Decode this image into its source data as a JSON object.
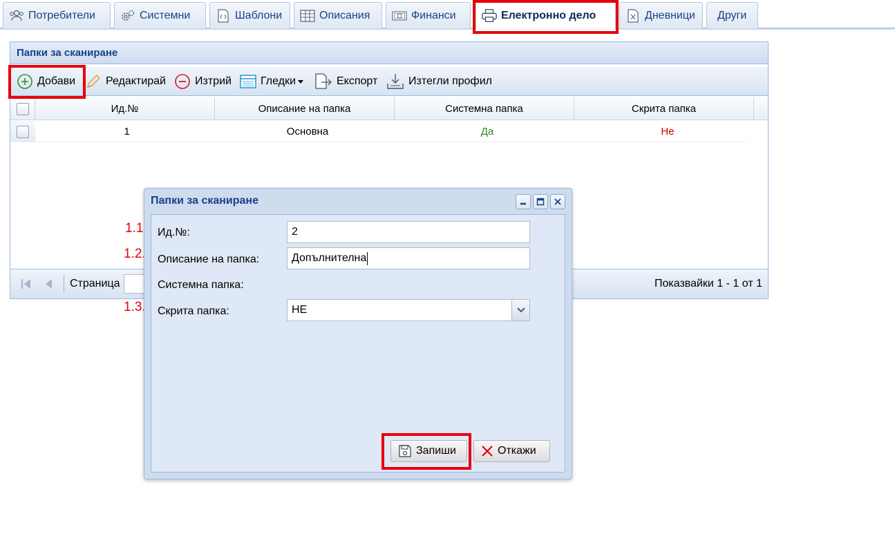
{
  "tabs": [
    {
      "label": "Потребители",
      "icon": "users-icon"
    },
    {
      "label": "Системни",
      "icon": "gears-icon"
    },
    {
      "label": "Шаблони",
      "icon": "code-file-icon"
    },
    {
      "label": "Описания",
      "icon": "table-icon"
    },
    {
      "label": "Финанси",
      "icon": "banknote-icon"
    },
    {
      "label": "Електронно дело",
      "icon": "printer-icon",
      "active": true
    },
    {
      "label": "Дневници",
      "icon": "excel-file-icon"
    },
    {
      "label": "Други",
      "icon": ""
    }
  ],
  "panel": {
    "title": "Папки за сканиране",
    "toolbar": {
      "add": "Добави",
      "edit": "Редактирай",
      "delete": "Изтрий",
      "views": "Гледки",
      "export": "Експорт",
      "download_profile": "Изтегли профил"
    },
    "columns": [
      "Ид.№",
      "Описание на папка",
      "Системна папка",
      "Скрита папка"
    ],
    "rows": [
      {
        "id": "1",
        "description": "Основна",
        "system": "Да",
        "hidden": "Не"
      }
    ],
    "pager": {
      "page_label": "Страница",
      "summary": "Показвайки 1 - 1 от 1"
    }
  },
  "dialog": {
    "title": "Папки за сканиране",
    "fields": {
      "id_label": "Ид.№:",
      "id_value": "2",
      "desc_label": "Описание на папка:",
      "desc_value": "Допълнителна",
      "system_label": "Системна папка:",
      "hidden_label": "Скрита папка:",
      "hidden_value": "НЕ"
    },
    "annotations": [
      "1.1.",
      "1.2.",
      "1.3."
    ],
    "save": "Запиши",
    "cancel": "Откажи"
  },
  "colors": {
    "accent_red": "#e8000b",
    "yes_green": "#2e8b1e",
    "no_red": "#d40000",
    "header_blue": "#15428b"
  }
}
